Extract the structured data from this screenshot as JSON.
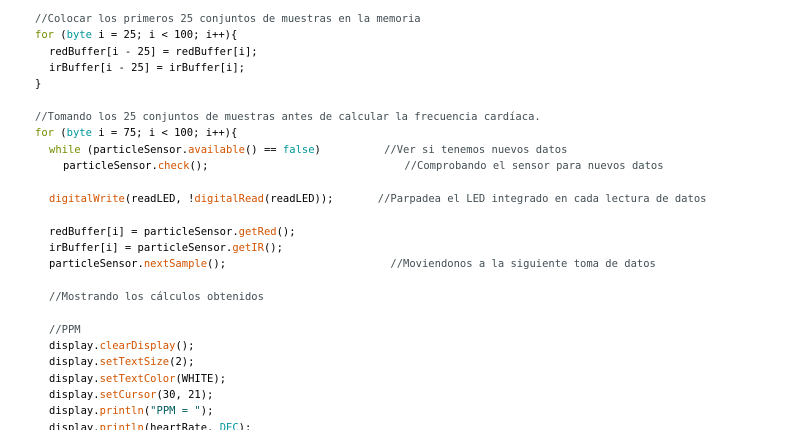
{
  "editor": {
    "colors": {
      "background": "#ffffff",
      "comment": "#434f54",
      "keyword": "#728e00",
      "type": "#00979c",
      "function": "#d35400",
      "plain": "#000000",
      "string": "#005c5f"
    },
    "lines": [
      {
        "indent": 2,
        "tokens": [
          {
            "t": "//Colocar los primeros 25 conjuntos de muestras en la memoria",
            "c": "comment"
          }
        ]
      },
      {
        "indent": 2,
        "tokens": [
          {
            "t": "for",
            "c": "keyword"
          },
          {
            "t": " (",
            "c": "plain"
          },
          {
            "t": "byte",
            "c": "type"
          },
          {
            "t": " i = 25; i < 100; i++){",
            "c": "plain"
          }
        ]
      },
      {
        "indent": 4,
        "tokens": [
          {
            "t": "redBuffer[i - 25] = redBuffer[i];",
            "c": "plain"
          }
        ]
      },
      {
        "indent": 4,
        "tokens": [
          {
            "t": "irBuffer[i - 25] = irBuffer[i];",
            "c": "plain"
          }
        ]
      },
      {
        "indent": 2,
        "tokens": [
          {
            "t": "}",
            "c": "plain"
          }
        ]
      },
      {
        "indent": 2,
        "tokens": []
      },
      {
        "indent": 2,
        "tokens": [
          {
            "t": "//Tomando los 25 conjuntos de muestras antes de calcular la frecuencia cardíaca.",
            "c": "comment"
          }
        ]
      },
      {
        "indent": 2,
        "tokens": [
          {
            "t": "for",
            "c": "keyword"
          },
          {
            "t": " (",
            "c": "plain"
          },
          {
            "t": "byte",
            "c": "type"
          },
          {
            "t": " i = 75; i < 100; i++){",
            "c": "plain"
          }
        ]
      },
      {
        "indent": 4,
        "tokens": [
          {
            "t": "while",
            "c": "keyword"
          },
          {
            "t": " (particleSensor.",
            "c": "plain"
          },
          {
            "t": "available",
            "c": "func"
          },
          {
            "t": "() == ",
            "c": "plain"
          },
          {
            "t": "false",
            "c": "type"
          },
          {
            "t": ")          ",
            "c": "plain"
          },
          {
            "t": "//Ver si tenemos nuevos datos",
            "c": "comment"
          }
        ]
      },
      {
        "indent": 6,
        "tokens": [
          {
            "t": "particleSensor.",
            "c": "plain"
          },
          {
            "t": "check",
            "c": "func"
          },
          {
            "t": "();                               ",
            "c": "plain"
          },
          {
            "t": "//Comprobando el sensor para nuevos datos",
            "c": "comment"
          }
        ]
      },
      {
        "indent": 4,
        "tokens": []
      },
      {
        "indent": 4,
        "tokens": [
          {
            "t": "digitalWrite",
            "c": "func"
          },
          {
            "t": "(readLED, !",
            "c": "plain"
          },
          {
            "t": "digitalRead",
            "c": "func"
          },
          {
            "t": "(readLED));       ",
            "c": "plain"
          },
          {
            "t": "//Parpadea el LED integrado en cada lectura de datos",
            "c": "comment"
          }
        ]
      },
      {
        "indent": 4,
        "tokens": []
      },
      {
        "indent": 4,
        "tokens": [
          {
            "t": "redBuffer[i] = particleSensor.",
            "c": "plain"
          },
          {
            "t": "getRed",
            "c": "func"
          },
          {
            "t": "();",
            "c": "plain"
          }
        ]
      },
      {
        "indent": 4,
        "tokens": [
          {
            "t": "irBuffer[i] = particleSensor.",
            "c": "plain"
          },
          {
            "t": "getIR",
            "c": "func"
          },
          {
            "t": "();",
            "c": "plain"
          }
        ]
      },
      {
        "indent": 4,
        "tokens": [
          {
            "t": "particleSensor.",
            "c": "plain"
          },
          {
            "t": "nextSample",
            "c": "func"
          },
          {
            "t": "();                          ",
            "c": "plain"
          },
          {
            "t": "//Moviendonos a la siguiente toma de datos",
            "c": "comment"
          }
        ]
      },
      {
        "indent": 4,
        "tokens": []
      },
      {
        "indent": 4,
        "tokens": [
          {
            "t": "//Mostrando los cálculos obtenidos",
            "c": "comment"
          }
        ]
      },
      {
        "indent": 4,
        "tokens": []
      },
      {
        "indent": 4,
        "tokens": [
          {
            "t": "//PPM",
            "c": "comment"
          }
        ]
      },
      {
        "indent": 4,
        "tokens": [
          {
            "t": "display.",
            "c": "plain"
          },
          {
            "t": "clearDisplay",
            "c": "func"
          },
          {
            "t": "();",
            "c": "plain"
          }
        ]
      },
      {
        "indent": 4,
        "tokens": [
          {
            "t": "display.",
            "c": "plain"
          },
          {
            "t": "setTextSize",
            "c": "func"
          },
          {
            "t": "(2);",
            "c": "plain"
          }
        ]
      },
      {
        "indent": 4,
        "tokens": [
          {
            "t": "display.",
            "c": "plain"
          },
          {
            "t": "setTextColor",
            "c": "func"
          },
          {
            "t": "(WHITE);",
            "c": "plain"
          }
        ]
      },
      {
        "indent": 4,
        "tokens": [
          {
            "t": "display.",
            "c": "plain"
          },
          {
            "t": "setCursor",
            "c": "func"
          },
          {
            "t": "(30, 21);",
            "c": "plain"
          }
        ]
      },
      {
        "indent": 4,
        "tokens": [
          {
            "t": "display.",
            "c": "plain"
          },
          {
            "t": "println",
            "c": "func"
          },
          {
            "t": "(",
            "c": "plain"
          },
          {
            "t": "\"PPM = \"",
            "c": "string"
          },
          {
            "t": ");",
            "c": "plain"
          }
        ]
      },
      {
        "indent": 4,
        "tokens": [
          {
            "t": "display.",
            "c": "plain"
          },
          {
            "t": "println",
            "c": "func"
          },
          {
            "t": "(heartRate, ",
            "c": "plain"
          },
          {
            "t": "DEC",
            "c": "type"
          },
          {
            "t": ");",
            "c": "plain"
          }
        ]
      }
    ]
  }
}
